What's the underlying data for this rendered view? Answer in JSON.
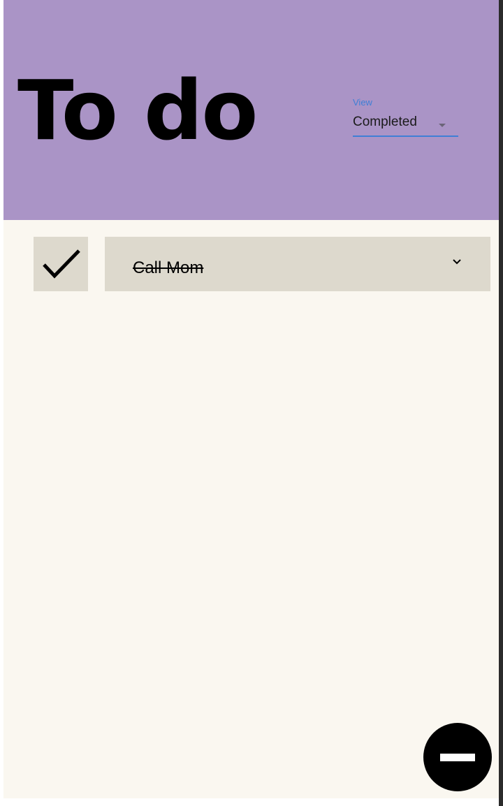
{
  "header": {
    "title": "To do",
    "background": "#aa94c6"
  },
  "view_select": {
    "label": "View",
    "value": "Completed",
    "accent": "#3f7fd6"
  },
  "todos": [
    {
      "text": "Call Mom",
      "completed": true
    }
  ],
  "fab": {
    "icon": "minus-icon"
  },
  "icons": {
    "check": "checkmark-icon",
    "expand": "chevron-down-icon",
    "select_caret": "caret-down-icon"
  }
}
